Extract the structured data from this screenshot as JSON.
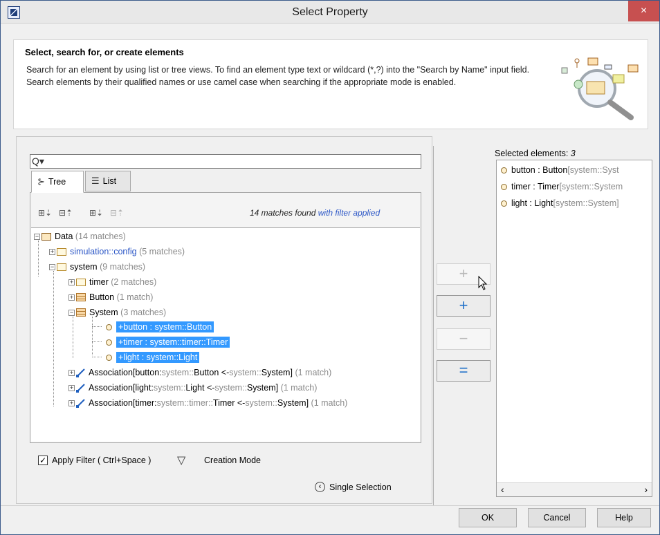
{
  "window": {
    "title": "Select Property",
    "close_label": "×"
  },
  "header": {
    "title": "Select, search for, or create elements",
    "description": "Search for an element by using list or tree views. To find an element type text or wildcard (*,?) into the \"Search by Name\" input field. Search elements by their qualified names or use camel case when searching if the appropriate mode is enabled."
  },
  "search": {
    "icon": "Q▾",
    "value": "",
    "placeholder": ""
  },
  "tabs": [
    {
      "label": "Tree",
      "icon": "tree-icon",
      "active": true
    },
    {
      "label": "List",
      "icon": "list-icon",
      "active": false
    }
  ],
  "matches": {
    "count_text": "14 matches found ",
    "filter_text": "with filter applied"
  },
  "tree": {
    "data": {
      "label": "Data",
      "count": "(14 matches)"
    },
    "simulation": {
      "label": "simulation::config",
      "count": "(5 matches)"
    },
    "system": {
      "label": "system",
      "count": "(9 matches)"
    },
    "timer": {
      "label": "timer",
      "count": "(2 matches)"
    },
    "button": {
      "label": "Button",
      "count": "(1 match)"
    },
    "systemcls": {
      "label": "System",
      "count": "(3 matches)"
    },
    "prop1": "+button : system::Button",
    "prop2": "+timer : system::timer::Timer",
    "prop3": "+light : system::Light",
    "assoc1": {
      "a": "Association[button:",
      "b": "system::",
      "c": "Button <- ",
      "d": "system::",
      "e": "System]",
      "count": "(1 match)"
    },
    "assoc2": {
      "a": "Association[light:",
      "b": "system::",
      "c": "Light <- ",
      "d": "system::",
      "e": "System]",
      "count": "(1 match)"
    },
    "assoc3": {
      "a": "Association[timer:",
      "b": "system::timer::",
      "c": "Timer <- ",
      "d": "system::",
      "e": "System]",
      "count": "(1 match)"
    }
  },
  "filter": {
    "checked_mark": "✓",
    "apply_label": "Apply Filter ( Ctrl+Space )",
    "creation_label": "Creation Mode"
  },
  "single_selection": {
    "icon": "‹",
    "label": "Single Selection"
  },
  "mid_buttons": {
    "add": "+",
    "add_new": "+",
    "remove": "−",
    "remove_all": "="
  },
  "selected": {
    "title": "Selected elements: ",
    "count": "3",
    "items": [
      {
        "name": "button : Button ",
        "qual": "[system::Syst"
      },
      {
        "name": "timer : Timer ",
        "qual": "[system::System"
      },
      {
        "name": "light : Light ",
        "qual": "[system::System]"
      }
    ],
    "scroll_left": "‹",
    "scroll_right": "›"
  },
  "dialog_buttons": {
    "ok": "OK",
    "cancel": "Cancel",
    "help": "Help"
  }
}
